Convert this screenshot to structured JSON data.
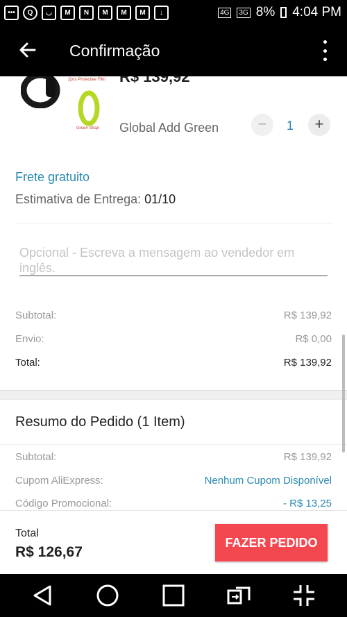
{
  "status_bar": {
    "time": "4:04 PM",
    "battery": "8%",
    "signal1": "4G",
    "signal2": "3G"
  },
  "app_bar": {
    "title": "Confirmação"
  },
  "product": {
    "price": "R$ 139,92",
    "variant": "Global Add Green",
    "quantity": "1",
    "image_labels": [
      "2pcs Protective Film",
      "Green Strap"
    ]
  },
  "shipping": {
    "label": "Frete gratuito",
    "estimate_label": "Estimativa de Entrega:",
    "estimate_date": "01/10"
  },
  "message": {
    "placeholder": "Opcional - Escreva a mensagem ao vendedor em inglês."
  },
  "store_summary": {
    "subtotal_label": "Subtotal:",
    "subtotal_value": "R$ 139,92",
    "shipping_label": "Envio:",
    "shipping_value": "R$ 0,00",
    "total_label": "Total:",
    "total_value": "R$ 139,92"
  },
  "order_summary": {
    "title": "Resumo do Pedido (1 Item)",
    "subtotal_label": "Subtotal:",
    "subtotal_value": "R$ 139,92",
    "coupon_label": "Cupom AliExpress:",
    "coupon_value": "Nenhum Cupom Disponível",
    "promo_label": "Código Promocional:",
    "promo_value": "- R$ 13,25"
  },
  "footer": {
    "total_label": "Total",
    "total_value": "R$ 126,67",
    "order_button": "FAZER PEDIDO"
  },
  "colors": {
    "accent_link": "#2a8ab0",
    "order_button": "#f5474f"
  }
}
